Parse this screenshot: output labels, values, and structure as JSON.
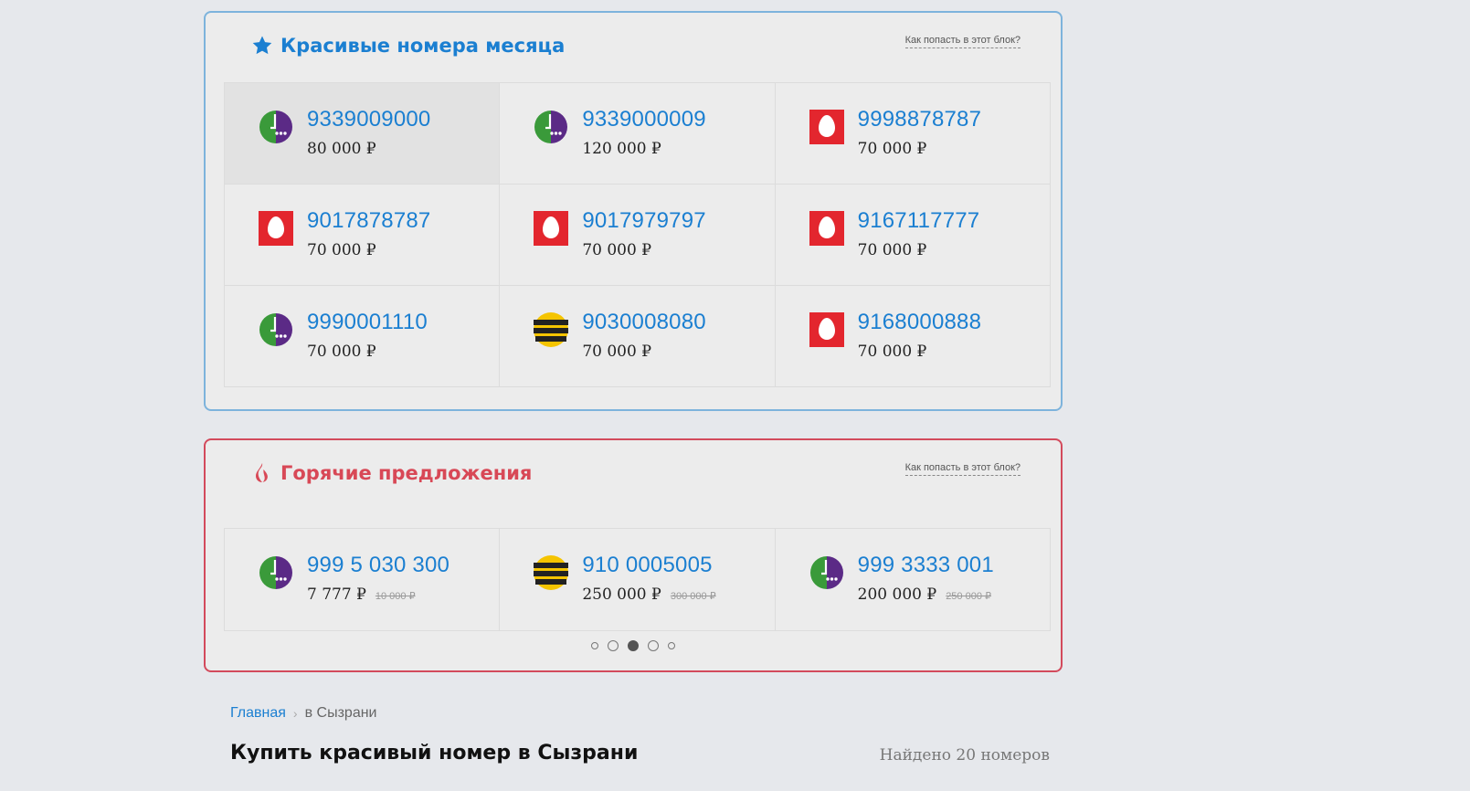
{
  "month_panel": {
    "title": "Красивые номера месяца",
    "title_icon": "star-icon",
    "help_link": "Как попасть в этот блок?",
    "items": [
      {
        "number": "9339009000",
        "price": "80 000 ₽",
        "operator": "megafon"
      },
      {
        "number": "9339000009",
        "price": "120 000 ₽",
        "operator": "megafon"
      },
      {
        "number": "9998878787",
        "price": "70 000 ₽",
        "operator": "mts"
      },
      {
        "number": "9017878787",
        "price": "70 000 ₽",
        "operator": "mts"
      },
      {
        "number": "9017979797",
        "price": "70 000 ₽",
        "operator": "mts"
      },
      {
        "number": "9167117777",
        "price": "70 000 ₽",
        "operator": "mts"
      },
      {
        "number": "9990001110",
        "price": "70 000 ₽",
        "operator": "megafon"
      },
      {
        "number": "9030008080",
        "price": "70 000 ₽",
        "operator": "beeline"
      },
      {
        "number": "9168000888",
        "price": "70 000 ₽",
        "operator": "mts"
      }
    ]
  },
  "hot_panel": {
    "title": "Горячие предложения",
    "title_icon": "fire-icon",
    "help_link": "Как попасть в этот блок?",
    "items": [
      {
        "number": "999 5 030 300",
        "price": "7 777 ₽",
        "old_price": "10 000 ₽",
        "operator": "megafon"
      },
      {
        "number": "910 0005005",
        "price": "250 000 ₽",
        "old_price": "300 000 ₽",
        "operator": "beeline"
      },
      {
        "number": "999 3333 001",
        "price": "200 000 ₽",
        "old_price": "250 000 ₽",
        "operator": "megafon"
      }
    ],
    "pagination": {
      "total": 5,
      "active": 3
    }
  },
  "breadcrumb": {
    "home": "Главная",
    "current": "в Сызрани"
  },
  "page_title": "Купить красивый номер в Сызрани",
  "found_text": "Найдено 20 номеров",
  "colors": {
    "accent_blue": "#1b7fd1",
    "hot_red": "#d84856",
    "megafon_green": "#3a9a3a",
    "megafon_purple": "#5b2a86",
    "mts_red": "#e3262e",
    "beeline_yellow": "#f5c400"
  }
}
